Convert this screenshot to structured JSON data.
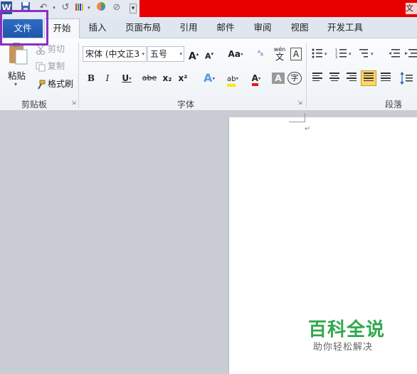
{
  "quick_access": {
    "icons": [
      "word-logo-icon",
      "save-icon",
      "undo-icon",
      "redo-icon",
      "format-painter-icon",
      "color-wheel-icon",
      "no-edit-icon",
      "customize-icon"
    ],
    "word_logo": "W",
    "title_fragment": "文"
  },
  "tabs": {
    "file": "文件",
    "home": "开始",
    "insert": "插入",
    "page_layout": "页面布局",
    "references": "引用",
    "mailings": "邮件",
    "review": "审阅",
    "view": "视图",
    "developer": "开发工具"
  },
  "ribbon": {
    "clipboard": {
      "label": "剪贴板",
      "paste": "粘贴",
      "cut": "剪切",
      "copy": "复制",
      "format_painter": "格式刷"
    },
    "font": {
      "label": "字体",
      "font_name": "宋体 (中文正3",
      "font_size": "五号",
      "grow": "A",
      "shrink": "A",
      "change_case": "Aa",
      "bold": "B",
      "italic": "I",
      "underline": "U",
      "strikethrough": "abe",
      "subscript": "x₂",
      "superscript": "x²",
      "font_color": "A",
      "char_shading": "A",
      "enclose": "字",
      "pinyin": "wén"
    },
    "paragraph": {
      "label": "段落"
    }
  },
  "document": {
    "paragraph_mark": "↵"
  },
  "watermark": {
    "main": "百科全说",
    "sub": "助你轻松解决"
  },
  "colors": {
    "title_bar_red": "#e60000",
    "file_tab_blue": "#1e56ab",
    "highlight_purple": "#8a2fc4",
    "watermark_green": "#2fa84b",
    "font_color_red": "#e21a1a",
    "highlight_yellow": "#ffe600"
  }
}
